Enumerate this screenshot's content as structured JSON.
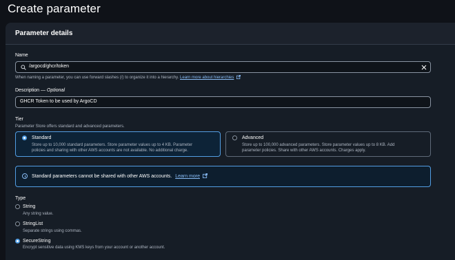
{
  "page": {
    "title": "Create parameter"
  },
  "panel": {
    "title": "Parameter details"
  },
  "name": {
    "label": "Name",
    "value": "/argocd/ghcr/token",
    "hint": "When naming a parameter, you can use forward slashes (/) to organize it into a hierarchy.",
    "hint_link": "Learn more about hierarchies"
  },
  "description": {
    "label": "Description",
    "optional": "Optional",
    "value": "GHCR Token to be used by ArgoCD"
  },
  "tier": {
    "label": "Tier",
    "hint": "Parameter Store offers standard and advanced parameters.",
    "options": [
      {
        "title": "Standard",
        "line1": "Store up to 10,000 standard parameters. Store parameter values up to 4 KB. Parameter",
        "line2": "policies and sharing with other AWS accounts are not available. No additional charge.",
        "selected": true
      },
      {
        "title": "Advanced",
        "line1": "Store up to 100,000 advanced parameters. Store parameter values up to 8 KB. Add",
        "line2": "parameter policies. Share with other AWS accounts. Charges apply.",
        "selected": false
      }
    ]
  },
  "info_alert": {
    "text": "Standard parameters cannot be shared with other AWS accounts.",
    "link": "Learn more"
  },
  "type": {
    "label": "Type",
    "options": [
      {
        "title": "String",
        "desc": "Any string value.",
        "selected": false
      },
      {
        "title": "StringList",
        "desc": "Separate strings using commas.",
        "selected": false
      },
      {
        "title": "SecureString",
        "desc": "Encrypt sensitive data using KMS keys from your account or another account.",
        "selected": true
      }
    ]
  },
  "colors": {
    "accent": "#539fe5",
    "link": "#89bdf7",
    "background": "#0f1218",
    "panel": "#161d26"
  }
}
